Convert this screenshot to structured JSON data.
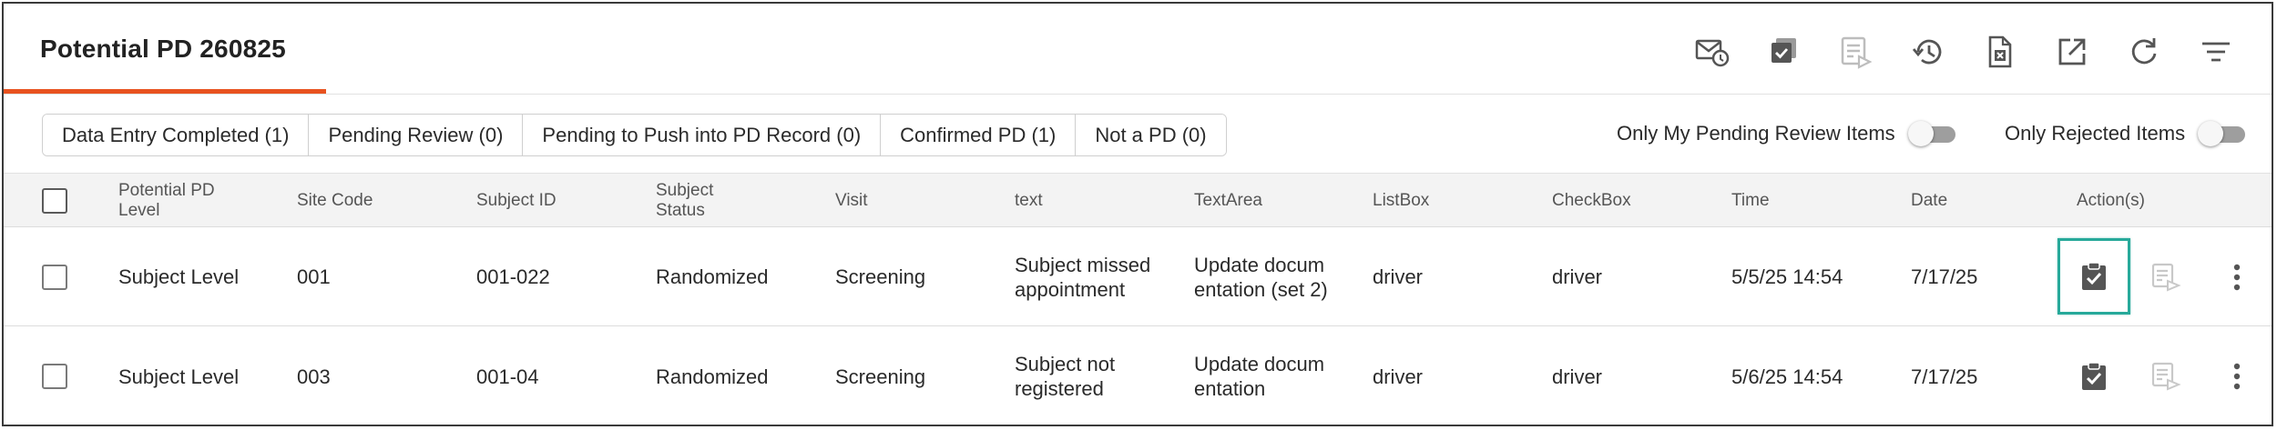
{
  "header": {
    "title": "Potential PD 260825",
    "toolbar_icons": [
      "mail-clock-icon",
      "copy-check-icon",
      "review-list-icon",
      "history-icon",
      "export-file-icon",
      "open-external-icon",
      "refresh-icon",
      "filter-lines-icon"
    ]
  },
  "filters": {
    "tabs": [
      {
        "label": "Data Entry Completed (1)"
      },
      {
        "label": "Pending Review (0)"
      },
      {
        "label": "Pending to Push into PD Record (0)"
      },
      {
        "label": "Confirmed PD (1)"
      },
      {
        "label": "Not a PD (0)"
      }
    ],
    "toggle_my_pending": {
      "label": "Only My Pending Review Items",
      "on": false
    },
    "toggle_rejected": {
      "label": "Only Rejected Items",
      "on": false
    }
  },
  "table": {
    "columns": {
      "level": "Potential PD Level",
      "site_code": "Site Code",
      "subject_id": "Subject ID",
      "subject_status": "Subject Status",
      "visit": "Visit",
      "text": "text",
      "textarea": "TextArea",
      "listbox": "ListBox",
      "checkbox": "CheckBox",
      "time": "Time",
      "date": "Date",
      "actions": "Action(s)"
    },
    "rows": [
      {
        "level": "Subject Level",
        "site_code": "001",
        "subject_id": "001-022",
        "subject_status": "Randomized",
        "visit": "Screening",
        "text": "Subject missed appointment",
        "textarea": "Update documentation (set 2)",
        "listbox": "driver",
        "checkbox": "driver",
        "time": "5/5/25 14:54",
        "date": "7/17/25"
      },
      {
        "level": "Subject Level",
        "site_code": "003",
        "subject_id": "001-04",
        "subject_status": "Randomized",
        "visit": "Screening",
        "text": "Subject not registered",
        "textarea": "Update documentation",
        "listbox": "driver",
        "checkbox": "driver",
        "time": "5/6/25 14:54",
        "date": "7/17/25"
      }
    ],
    "row_action_icons": [
      "clipboard-check-icon",
      "review-push-icon",
      "more-vert-icon"
    ]
  },
  "colors": {
    "accent": "#e8521f",
    "focus": "#27a99a",
    "icon": "#555555",
    "icon_disabled": "#c8c8c8"
  }
}
